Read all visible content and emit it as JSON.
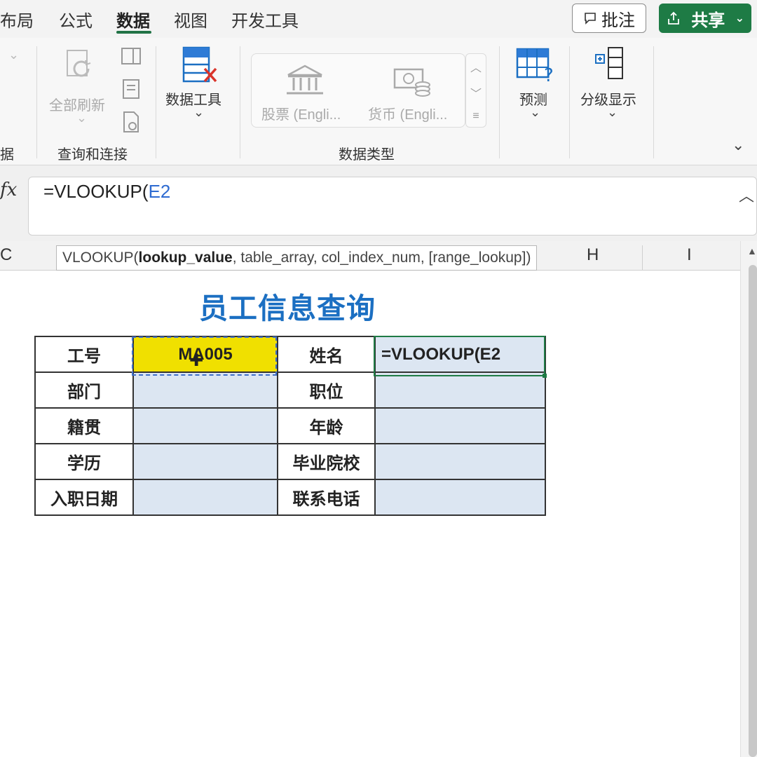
{
  "tabs": [
    {
      "label": "布局",
      "visible_label": "布局"
    },
    {
      "label": "公式"
    },
    {
      "label": "数据",
      "active": true
    },
    {
      "label": "视图"
    },
    {
      "label": "开发工具"
    }
  ],
  "header": {
    "comment_label": "批注",
    "share_label": "共享"
  },
  "ribbon": {
    "left_partial_label": "据",
    "refresh_all_label": "全部刷新",
    "query_group_label": "查询和连接",
    "data_tools_label": "数据工具",
    "stocks_label": "股票 (Engli...",
    "currency_label": "货币 (Engli...",
    "data_types_group_label": "数据类型",
    "forecast_label": "预测",
    "outline_label": "分级显示"
  },
  "formula_bar": {
    "fx": "fx",
    "prefix": "=VLOOKUP(",
    "ref": "E2"
  },
  "column_headers": [
    "C",
    "H",
    "I"
  ],
  "tooltip": {
    "func": "VLOOKUP(",
    "arg1": "lookup_value",
    "rest": ", table_array, col_index_num, [range_lookup])"
  },
  "sheet": {
    "title": "员工信息查询",
    "rows": [
      {
        "label1": "工号",
        "value1": "MA005",
        "label2": "姓名",
        "value2": "=VLOOKUP(E2"
      },
      {
        "label1": "部门",
        "value1": "",
        "label2": "职位",
        "value2": ""
      },
      {
        "label1": "籍贯",
        "value1": "",
        "label2": "年龄",
        "value2": ""
      },
      {
        "label1": "学历",
        "value1": "",
        "label2": "毕业院校",
        "value2": ""
      },
      {
        "label1": "入职日期",
        "value1": "",
        "label2": "联系电话",
        "value2": ""
      }
    ]
  },
  "colors": {
    "accent_green": "#1e7b45",
    "title_blue": "#1b6fc2",
    "lookup_yellow": "#f0e000",
    "cell_blue": "#dce6f2"
  }
}
